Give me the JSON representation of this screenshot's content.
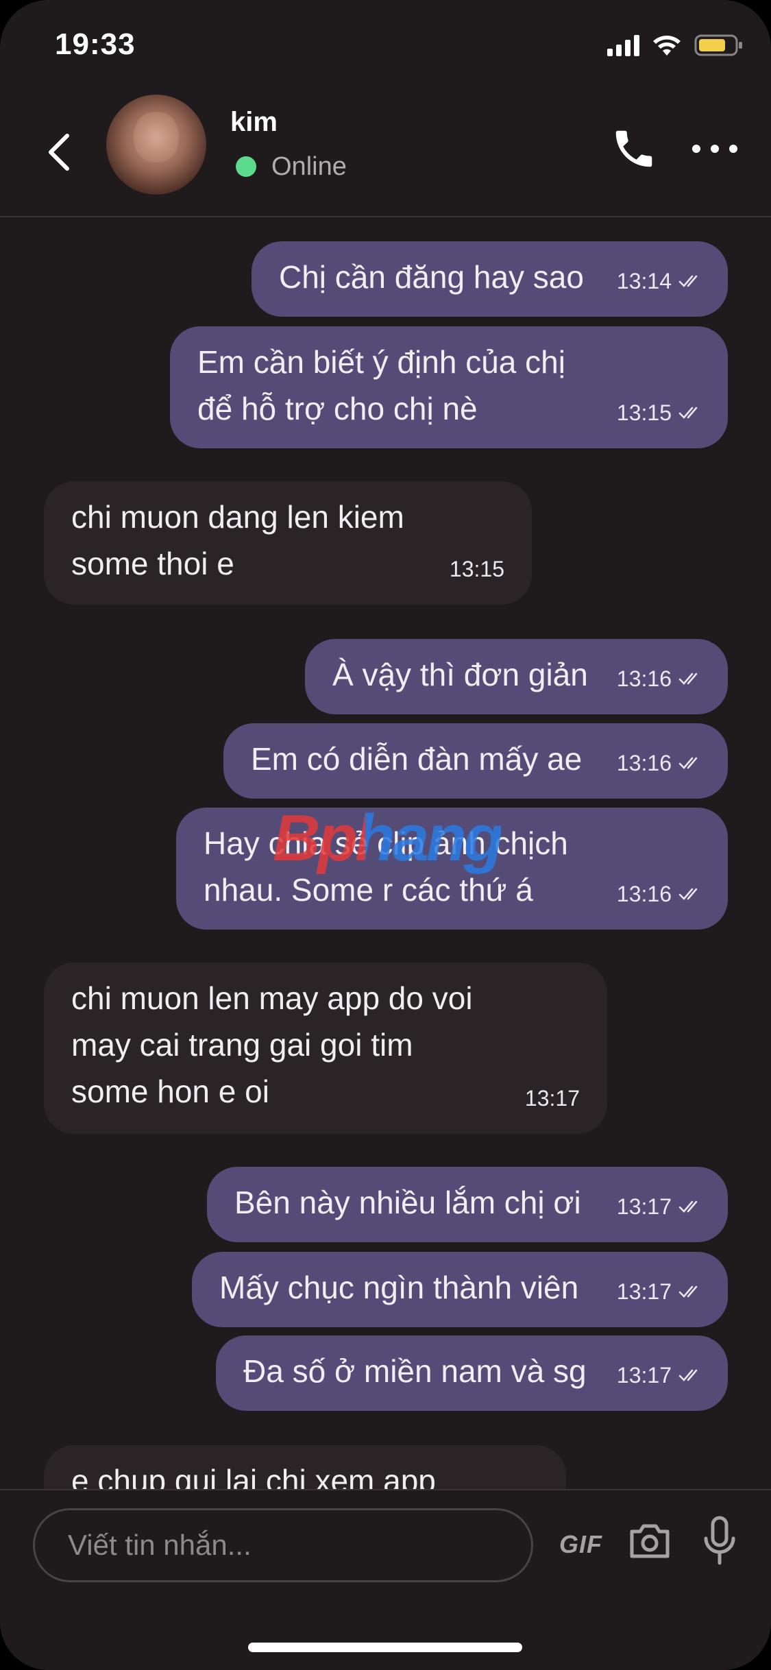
{
  "status_bar": {
    "time": "19:33"
  },
  "header": {
    "contact_name": "kim",
    "status": "Online"
  },
  "messages": [
    {
      "direction": "out",
      "text": "Chị cần đăng hay sao",
      "time": "13:14",
      "read": true
    },
    {
      "direction": "out",
      "text": "Em cần biết ý định của chị\nđể hỗ trợ cho chị nè",
      "time": "13:15",
      "read": true
    },
    {
      "direction": "in",
      "text": "chi muon dang len kiem\nsome thoi e",
      "time": "13:15"
    },
    {
      "direction": "out",
      "text": "À vậy thì đơn giản",
      "time": "13:16",
      "read": true
    },
    {
      "direction": "out",
      "text": "Em có diễn đàn mấy ae",
      "time": "13:16",
      "read": true
    },
    {
      "direction": "out",
      "text": "Hay chia sẻ clip ảnh chịch\nnhau. Some r các thứ á",
      "time": "13:16",
      "read": true
    },
    {
      "direction": "in",
      "text": "chi muon len may app do voi\nmay cai trang gai goi tim\nsome hon e oi",
      "time": "13:17"
    },
    {
      "direction": "out",
      "text": "Bên này nhiều lắm chị ơi",
      "time": "13:17",
      "read": true
    },
    {
      "direction": "out",
      "text": "Mấy chục ngìn thành viên",
      "time": "13:17",
      "read": true
    },
    {
      "direction": "out",
      "text": "Đa số ở miền nam và sg",
      "time": "13:17",
      "read": true
    },
    {
      "direction": "in",
      "text": "e chup gui lai chi xem app",
      "time": ""
    }
  ],
  "watermark": "Bphang",
  "composer": {
    "placeholder": "Viết tin nhắn...",
    "gif_label": "GIF"
  },
  "colors": {
    "background": "#1f1a1c",
    "outgoing_bubble": "#544c76",
    "incoming_bubble": "#2a2426",
    "online": "#5ddb8c",
    "battery": "#f2d04b"
  },
  "icons": [
    "back-chevron-icon",
    "phone-icon",
    "more-dots-icon",
    "camera-icon",
    "microphone-icon",
    "double-check-icon"
  ]
}
